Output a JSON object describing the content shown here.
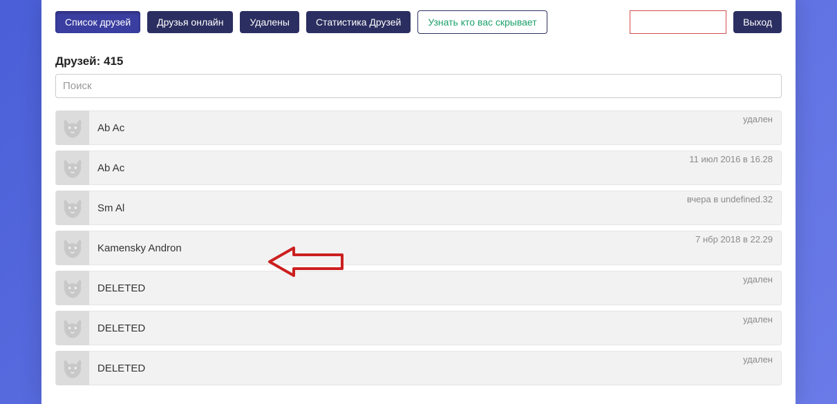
{
  "toolbar": {
    "friends_list": "Список друзей",
    "friends_online": "Друзья онлайн",
    "deleted": "Удалены",
    "stats": "Статистика Друзей",
    "hidden": "Узнать кто вас скрывает",
    "logout": "Выход"
  },
  "heading": "Друзей: 415",
  "search_placeholder": "Поиск",
  "rows": [
    {
      "name": "Ab Ac",
      "status": "удален"
    },
    {
      "name": "Ab Ac",
      "status": "11 июл 2016 в 16.28"
    },
    {
      "name": "Sm Al",
      "status": "вчера в undefined.32"
    },
    {
      "name": "Kamensky Andron",
      "status": "7 нбр 2018 в 22.29"
    },
    {
      "name": "DELETED",
      "status": "удален"
    },
    {
      "name": "DELETED",
      "status": "удален"
    },
    {
      "name": "DELETED",
      "status": "удален"
    }
  ]
}
